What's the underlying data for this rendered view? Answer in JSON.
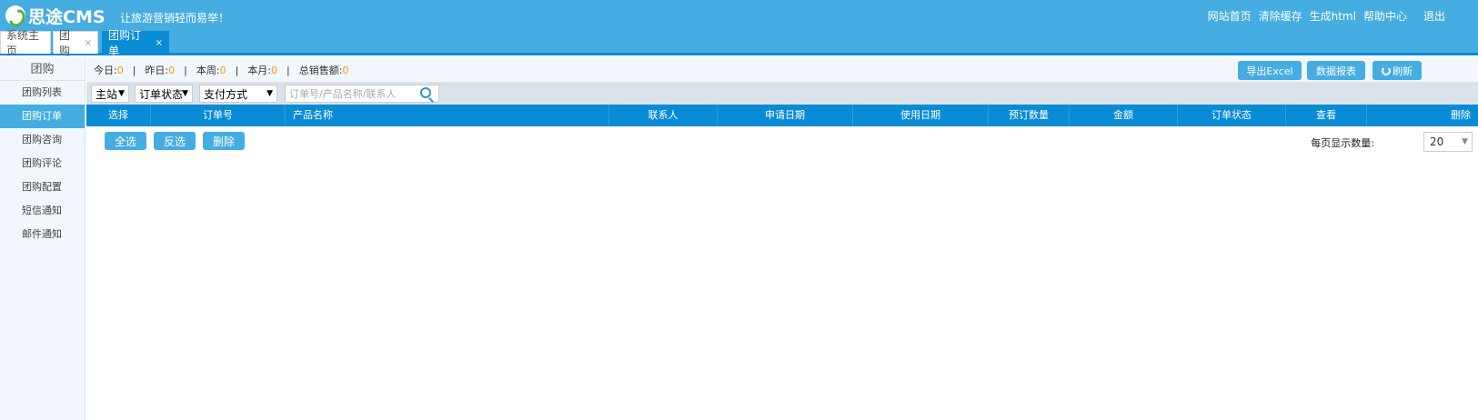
{
  "header": {
    "logo_text": "思途CMS",
    "slogan": "让旅游营销轻而易举！",
    "links": [
      "网站首页",
      "清除缓存",
      "生成html",
      "帮助中心"
    ],
    "logout": "退出"
  },
  "tabs": [
    {
      "label": "系统主页",
      "closable": false
    },
    {
      "label": "团购",
      "closable": true
    },
    {
      "label": "团购订单",
      "closable": true
    }
  ],
  "sidebar": {
    "title": "团购",
    "items": [
      "团购列表",
      "团购订单",
      "团购咨询",
      "团购评论",
      "团购配置",
      "短信通知",
      "邮件通知"
    ],
    "active": "团购订单"
  },
  "stats": {
    "today_label": "今日:",
    "today": "0",
    "yesterday_label": "昨日:",
    "yesterday": "0",
    "week_label": "本周:",
    "week": "0",
    "month_label": "本月:",
    "month": "0",
    "total_label": "总销售额:",
    "total": "0",
    "separator": "|"
  },
  "actions": {
    "export": "导出Excel",
    "report": "数据报表",
    "refresh": "刷新"
  },
  "filters": {
    "site": "主站",
    "status": "订单状态",
    "payment": "支付方式",
    "search_placeholder": "订单号/产品名称/联系人",
    "arrow": "▼"
  },
  "table": {
    "columns": [
      "选择",
      "订单号",
      "产品名称",
      "联系人",
      "申请日期",
      "使用日期",
      "预订数量",
      "金额",
      "订单状态",
      "查看",
      "删除"
    ]
  },
  "ops": {
    "select_all": "全选",
    "invert": "反选",
    "delete": "删除",
    "page_size_label": "每页显示数量:",
    "page_size": "20"
  },
  "colors": {
    "header": "#45ade1",
    "table_head": "#0a8bd6",
    "accent_number": "#f39c12"
  }
}
